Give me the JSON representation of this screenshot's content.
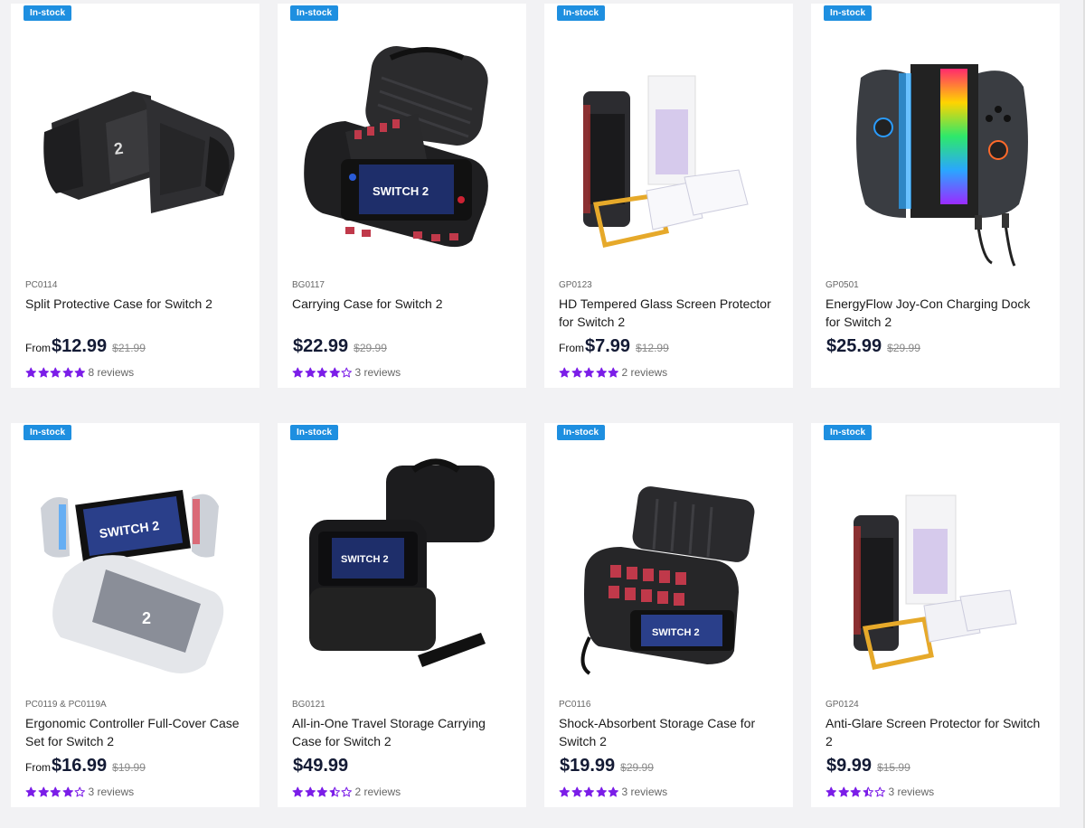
{
  "colors": {
    "badge": "#1e8fe0",
    "star": "#7b1de8",
    "price": "#131a34",
    "background": "#f2f2f4"
  },
  "products": [
    {
      "badge": "In-stock",
      "sku": "PC0114",
      "title": "Split Protective Case for Switch 2",
      "from_label": "From",
      "price": "$12.99",
      "old_price": "$21.99",
      "rating": 5,
      "reviews": "8 reviews",
      "image_icon": "split-case-image"
    },
    {
      "badge": "In-stock",
      "sku": "BG0117",
      "title": "Carrying Case for Switch 2",
      "from_label": "",
      "price": "$22.99",
      "old_price": "$29.99",
      "rating": 4,
      "reviews": "3 reviews",
      "image_icon": "carrying-case-image"
    },
    {
      "badge": "In-stock",
      "sku": "GP0123",
      "title": "HD Tempered Glass Screen Protector for Switch 2",
      "from_label": "From",
      "price": "$7.99",
      "old_price": "$12.99",
      "rating": 5,
      "reviews": "2 reviews",
      "image_icon": "screen-protector-image"
    },
    {
      "badge": "In-stock",
      "sku": "GP0501",
      "title": "EnergyFlow Joy-Con Charging Dock for Switch 2",
      "from_label": "",
      "price": "$25.99",
      "old_price": "$29.99",
      "rating": null,
      "reviews": "",
      "image_icon": "charging-dock-image"
    },
    {
      "badge": "In-stock",
      "sku": "PC0119 & PC0119A",
      "title": "Ergonomic Controller Full-Cover Case Set for Switch 2",
      "from_label": "From",
      "price": "$16.99",
      "old_price": "$19.99",
      "rating": 4,
      "reviews": "3 reviews",
      "image_icon": "full-cover-case-image"
    },
    {
      "badge": "In-stock",
      "sku": "BG0121",
      "title": "All-in-One Travel Storage Carrying Case for Switch 2",
      "from_label": "",
      "price": "$49.99",
      "old_price": "",
      "rating": 3.5,
      "reviews": "2 reviews",
      "image_icon": "travel-bag-image"
    },
    {
      "badge": "In-stock",
      "sku": "PC0116",
      "title": "Shock-Absorbent Storage Case for Switch 2",
      "from_label": "",
      "price": "$19.99",
      "old_price": "$29.99",
      "rating": 5,
      "reviews": "3 reviews",
      "image_icon": "storage-case-image"
    },
    {
      "badge": "In-stock",
      "sku": "GP0124",
      "title": "Anti-Glare Screen Protector for Switch 2",
      "from_label": "",
      "price": "$9.99",
      "old_price": "$15.99",
      "rating": 3.5,
      "reviews": "3 reviews",
      "image_icon": "anti-glare-protector-image"
    }
  ]
}
